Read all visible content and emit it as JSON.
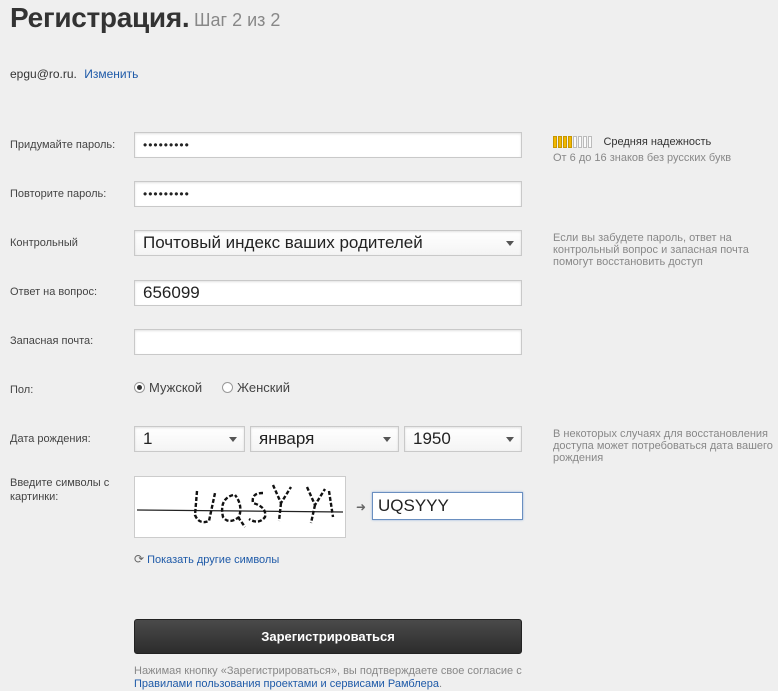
{
  "header": {
    "title": "Регистрация.",
    "step": "Шаг 2 из 2"
  },
  "account": {
    "email": "epgu@ro.ru.",
    "change_link": "Изменить"
  },
  "form": {
    "password": {
      "label": "Придумайте пароль:",
      "value": "•••••••••"
    },
    "password_repeat": {
      "label": "Повторите пароль:",
      "value": "•••••••••"
    },
    "security_question": {
      "label": "Контрольный",
      "value": "Почтовый индекс ваших родителей"
    },
    "answer": {
      "label": "Ответ на вопрос:",
      "value": "656099"
    },
    "backup_email": {
      "label": "Запасная почта:",
      "value": ""
    },
    "gender": {
      "label": "Пол:",
      "options": [
        "Мужской",
        "Женский"
      ],
      "selected": "Мужской"
    },
    "birthdate": {
      "label": "Дата рождения:",
      "day": "1",
      "month": "января",
      "year": "1950"
    },
    "captcha": {
      "label": "Введите символы с картинки:",
      "value": "UQSYYY",
      "refresh_link": "Показать другие символы"
    },
    "submit_label": "Зарегистрироваться"
  },
  "hints": {
    "strength_level": 4,
    "strength_total": 8,
    "strength_label": "Средняя надежность",
    "password_rule": "От 6 до 16 знаков без русских букв",
    "question_hint": "Если вы забудете пароль, ответ на контрольный вопрос и запасная почта помогут восстановить доступ",
    "birthdate_hint": "В некоторых случаях для восстановления доступа может потребоваться дата вашего рождения"
  },
  "terms": {
    "text": "Нажимая кнопку «Зарегистрироваться», вы подтверждаете свое согласие с",
    "link": "Правилами пользования проектами и сервисами Рамблера",
    "end": "."
  },
  "colors": {
    "accent_link": "#1e5aa8",
    "strength_fill": "#f2b800",
    "button": "#333333"
  }
}
